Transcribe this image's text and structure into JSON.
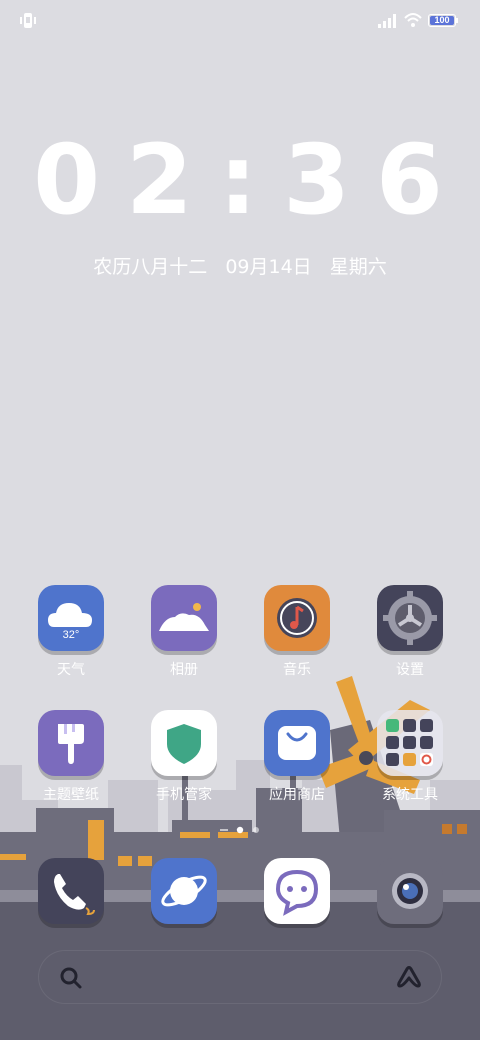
{
  "status_bar": {
    "battery": "100",
    "icons": [
      "vibrate-icon",
      "signal-icon",
      "wifi-icon",
      "battery-icon"
    ]
  },
  "clock": {
    "time": "02:36",
    "lunar_date": "农历八月十二",
    "date": "09月14日",
    "weekday": "星期六"
  },
  "apps": [
    {
      "name": "weather",
      "label": "天气",
      "temp": "32°",
      "icon": "weather-icon"
    },
    {
      "name": "gallery",
      "label": "相册",
      "icon": "photo-icon"
    },
    {
      "name": "music",
      "label": "音乐",
      "icon": "music-icon"
    },
    {
      "name": "settings",
      "label": "设置",
      "icon": "gear-icon"
    },
    {
      "name": "themes",
      "label": "主题壁纸",
      "icon": "paintbrush-icon"
    },
    {
      "name": "phone-manager",
      "label": "手机管家",
      "icon": "shield-icon"
    },
    {
      "name": "app-store",
      "label": "应用商店",
      "icon": "shopping-bag-icon"
    },
    {
      "name": "system-tools",
      "label": "系统工具",
      "icon": "folder-icon"
    }
  ],
  "dock": [
    {
      "name": "phone",
      "icon": "phone-icon"
    },
    {
      "name": "browser",
      "icon": "planet-icon"
    },
    {
      "name": "messages",
      "icon": "chat-icon"
    },
    {
      "name": "camera",
      "icon": "camera-icon"
    }
  ],
  "pager": {
    "pages": 3,
    "current": 2
  },
  "colors": {
    "background": "#dcdce1",
    "ground": "#5e5d6c",
    "accent_orange": "#e6a23c",
    "weather": "#4f74cc",
    "gallery": "#7b6bbd",
    "music": "#e08a3c",
    "settings": "#44445a",
    "themes": "#7b6bbd",
    "store": "#4f74cc"
  }
}
